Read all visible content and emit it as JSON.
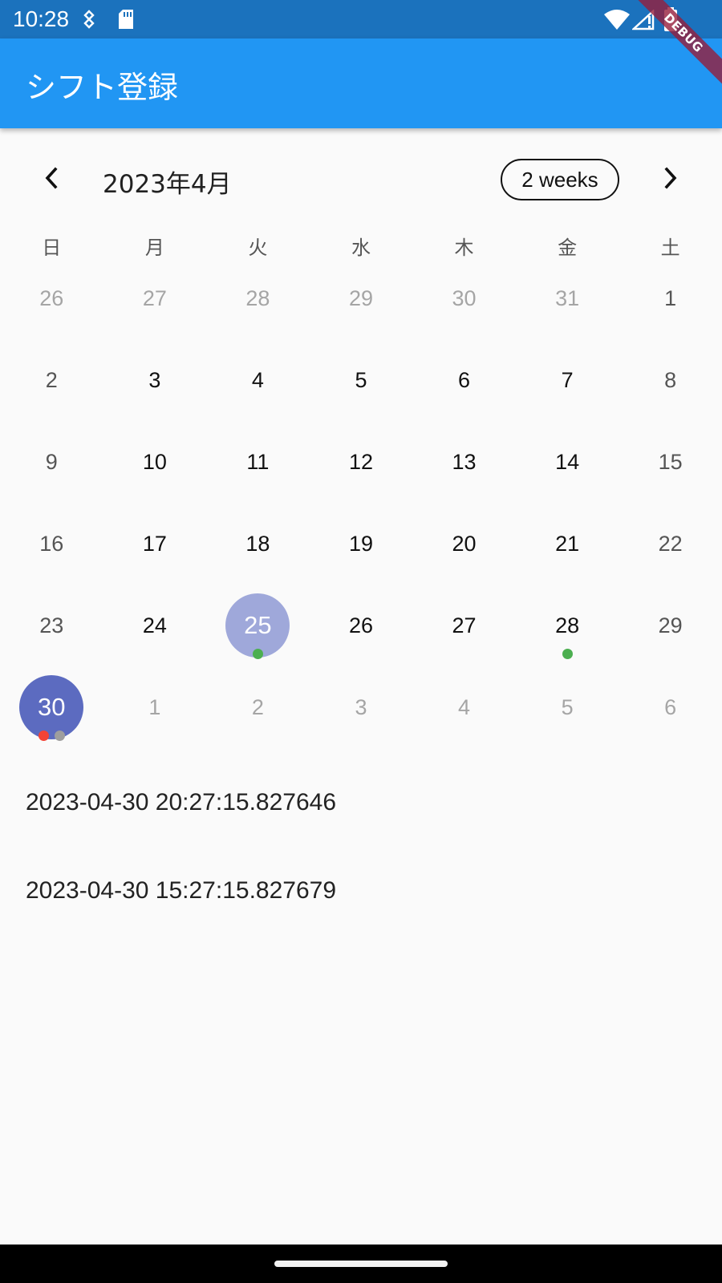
{
  "status_bar": {
    "time": "10:28",
    "icons": [
      "location-icon",
      "sd-card-icon",
      "wifi-icon",
      "signal-icon",
      "battery-icon"
    ],
    "color": "#1b72bd"
  },
  "app_bar": {
    "title": "シフト登録",
    "color": "#2196f3"
  },
  "debug_banner": {
    "label": "DEBUG"
  },
  "calendar": {
    "month_title": "2023年4月",
    "format_button": "2 weeks",
    "weekdays": [
      "日",
      "月",
      "火",
      "水",
      "木",
      "金",
      "土"
    ],
    "weeks": [
      [
        {
          "d": "26",
          "outside": true
        },
        {
          "d": "27",
          "outside": true
        },
        {
          "d": "28",
          "outside": true
        },
        {
          "d": "29",
          "outside": true
        },
        {
          "d": "30",
          "outside": true
        },
        {
          "d": "31",
          "outside": true
        },
        {
          "d": "1"
        }
      ],
      [
        {
          "d": "2"
        },
        {
          "d": "3"
        },
        {
          "d": "4"
        },
        {
          "d": "5"
        },
        {
          "d": "6"
        },
        {
          "d": "7"
        },
        {
          "d": "8"
        }
      ],
      [
        {
          "d": "9"
        },
        {
          "d": "10"
        },
        {
          "d": "11"
        },
        {
          "d": "12"
        },
        {
          "d": "13"
        },
        {
          "d": "14"
        },
        {
          "d": "15"
        }
      ],
      [
        {
          "d": "16"
        },
        {
          "d": "17"
        },
        {
          "d": "18"
        },
        {
          "d": "19"
        },
        {
          "d": "20"
        },
        {
          "d": "21"
        },
        {
          "d": "22"
        }
      ],
      [
        {
          "d": "23"
        },
        {
          "d": "24"
        },
        {
          "d": "25",
          "state": "today",
          "markers": [
            "#4caf50"
          ]
        },
        {
          "d": "26"
        },
        {
          "d": "27"
        },
        {
          "d": "28",
          "markers": [
            "#4caf50"
          ]
        },
        {
          "d": "29"
        }
      ],
      [
        {
          "d": "30",
          "state": "selected",
          "markers": [
            "#f44336",
            "#9e9e9e"
          ]
        },
        {
          "d": "1",
          "outside": true
        },
        {
          "d": "2",
          "outside": true
        },
        {
          "d": "3",
          "outside": true
        },
        {
          "d": "4",
          "outside": true
        },
        {
          "d": "5",
          "outside": true
        },
        {
          "d": "6",
          "outside": true
        }
      ]
    ],
    "today_color": "#9fa8da",
    "selected_color": "#5c6bc0"
  },
  "events": [
    {
      "label": "2023-04-30 20:27:15.827646"
    },
    {
      "label": "2023-04-30 15:27:15.827679"
    }
  ]
}
